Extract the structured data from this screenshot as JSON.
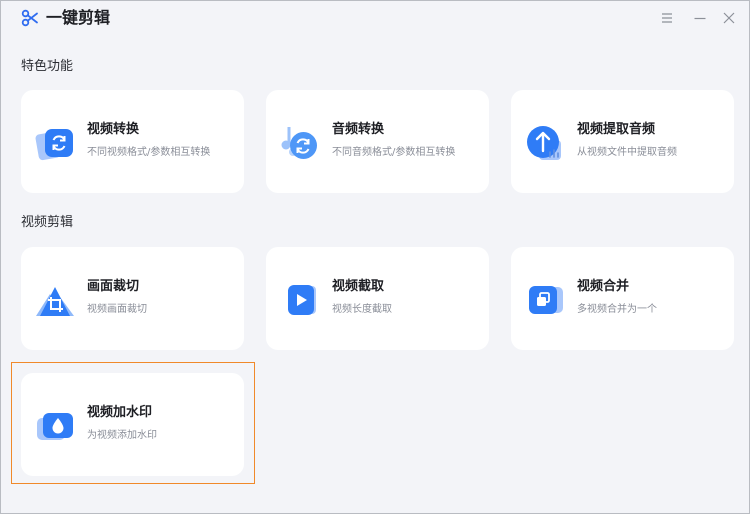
{
  "app": {
    "title": "一键剪辑",
    "logo_icon": "scissors-icon",
    "window_controls": [
      "menu-icon",
      "minimize-icon",
      "close-icon"
    ]
  },
  "sections": [
    {
      "title": "特色功能",
      "cards": [
        {
          "title": "视频转换",
          "desc": "不同视频格式/参数相互转换",
          "icon": "video-convert-icon"
        },
        {
          "title": "音频转换",
          "desc": "不同音频格式/参数相互转换",
          "icon": "audio-convert-icon"
        },
        {
          "title": "视频提取音频",
          "desc": "从视频文件中提取音频",
          "icon": "extract-audio-icon"
        }
      ]
    },
    {
      "title": "视频剪辑",
      "cards": [
        {
          "title": "画面裁切",
          "desc": "视频画面裁切",
          "icon": "crop-icon"
        },
        {
          "title": "视频截取",
          "desc": "视频长度截取",
          "icon": "video-trim-icon"
        },
        {
          "title": "视频合并",
          "desc": "多视频合并为一个",
          "icon": "video-merge-icon"
        },
        {
          "title": "视频加水印",
          "desc": "为视频添加水印",
          "icon": "watermark-icon",
          "selected": true
        }
      ]
    }
  ],
  "colors": {
    "accent": "#2f7cf6",
    "selection": "#f0892a",
    "background": "#f3f4f8"
  }
}
